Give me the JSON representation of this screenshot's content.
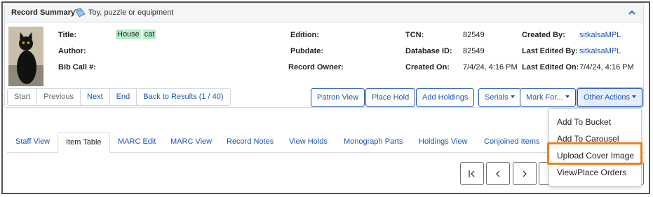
{
  "panel": {
    "title": "Record Summary",
    "item_type": "Toy, puzzle or equipment"
  },
  "fields": {
    "title_label": "Title:",
    "title_words": [
      "House",
      "cat"
    ],
    "author_label": "Author:",
    "bib_call_label": "Bib Call #:",
    "edition_label": "Edition:",
    "pubdate_label": "Pubdate:",
    "record_owner_label": "Record Owner:",
    "tcn_label": "TCN:",
    "tcn_value": "82549",
    "database_id_label": "Database ID:",
    "database_id_value": "82549",
    "created_on_label": "Created On:",
    "created_on_value": "7/4/24, 4:16 PM",
    "created_by_label": "Created By:",
    "created_by_value": "sitkalsaMPL",
    "last_edited_by_label": "Last Edited By:",
    "last_edited_by_value": "sitkalsaMPL",
    "last_edited_on_label": "Last Edited On:",
    "last_edited_on_value": "7/4/24, 4:16 PM"
  },
  "pager": {
    "start": "Start",
    "previous": "Previous",
    "next": "Next",
    "end": "End",
    "back_to_results": "Back to Results (1 / 40)"
  },
  "actions": {
    "patron_view": "Patron View",
    "place_hold": "Place Hold",
    "add_holdings": "Add Holdings",
    "serials": "Serials",
    "mark_for": "Mark For...",
    "other_actions": "Other Actions"
  },
  "tabs": [
    {
      "label": "Staff View"
    },
    {
      "label": "Item Table"
    },
    {
      "label": "MARC Edit"
    },
    {
      "label": "MARC View"
    },
    {
      "label": "Record Notes"
    },
    {
      "label": "View Holds"
    },
    {
      "label": "Monograph Parts"
    },
    {
      "label": "Holdings View"
    },
    {
      "label": "Conjoined Items"
    }
  ],
  "dropdown": {
    "items": [
      {
        "label": "Add To Bucket"
      },
      {
        "label": "Add To Carousel"
      },
      {
        "label": "Upload Cover Image"
      },
      {
        "label": "View/Place Orders"
      }
    ]
  },
  "nav_icons": [
    "first-page-icon",
    "previous-page-icon",
    "next-page-icon"
  ],
  "colors": {
    "link": "#1a56b8",
    "highlight": "#b6f2c9",
    "callout": "#e8831f"
  }
}
